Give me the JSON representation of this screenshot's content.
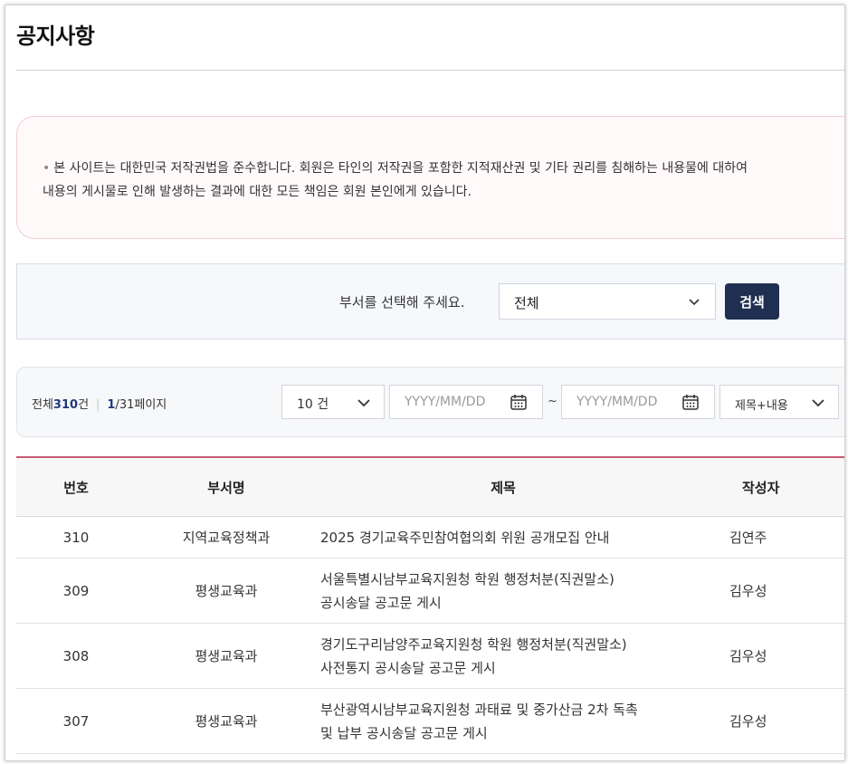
{
  "page": {
    "title": "공지사항"
  },
  "notice": {
    "line1": "본 사이트는 대한민국 저작권법을 준수합니다. 회원은 타인의 저작권을 포함한 지적재산권 및 기타 권리를 침해하는 내용물에 대하여",
    "line2": "내용의 게시물로 인해 발생하는 결과에 대한 모든 책임은 회원 본인에게 있습니다."
  },
  "filter": {
    "label": "부서를 선택해 주세요.",
    "department": "전체",
    "search_button": "검색"
  },
  "toolbar": {
    "total_prefix": "전체",
    "total_count": "310",
    "total_suffix": "건",
    "current_page": "1",
    "page_total": "/31페이지",
    "page_size": "10 건",
    "start_date_placeholder": "YYYY/MM/DD",
    "range_separator": "~",
    "end_date_placeholder": "YYYY/MM/DD",
    "search_field": "제목+내용"
  },
  "table": {
    "headers": {
      "no": "번호",
      "dept": "부서명",
      "title": "제목",
      "author": "작성자"
    },
    "rows": [
      {
        "no": "310",
        "dept": "지역교육정책과",
        "title1": "2025 경기교육주민참여협의회 위원 공개모집 안내",
        "title2": "",
        "author": "김연주"
      },
      {
        "no": "309",
        "dept": "평생교육과",
        "title1": "서울특별시남부교육지원청 학원 행정처분(직권말소)",
        "title2": "공시송달 공고문 게시",
        "author": "김우성"
      },
      {
        "no": "308",
        "dept": "평생교육과",
        "title1": "경기도구리남양주교육지원청 학원 행정처분(직권말소)",
        "title2": "사전통지 공시송달 공고문 게시",
        "author": "김우성"
      },
      {
        "no": "307",
        "dept": "평생교육과",
        "title1": "부산광역시남부교육지원청 과태료 및 중가산금 2차 독촉",
        "title2": "및 납부 공시송달 공고문 게시",
        "author": "김우성"
      }
    ]
  },
  "icons": {
    "dropdown": "chevron-down-icon",
    "calendar": "calendar-icon"
  },
  "colors": {
    "accent_navy": "#1f2f52",
    "table_top_border": "#c85a73",
    "count_highlight": "#1f3a7a"
  }
}
